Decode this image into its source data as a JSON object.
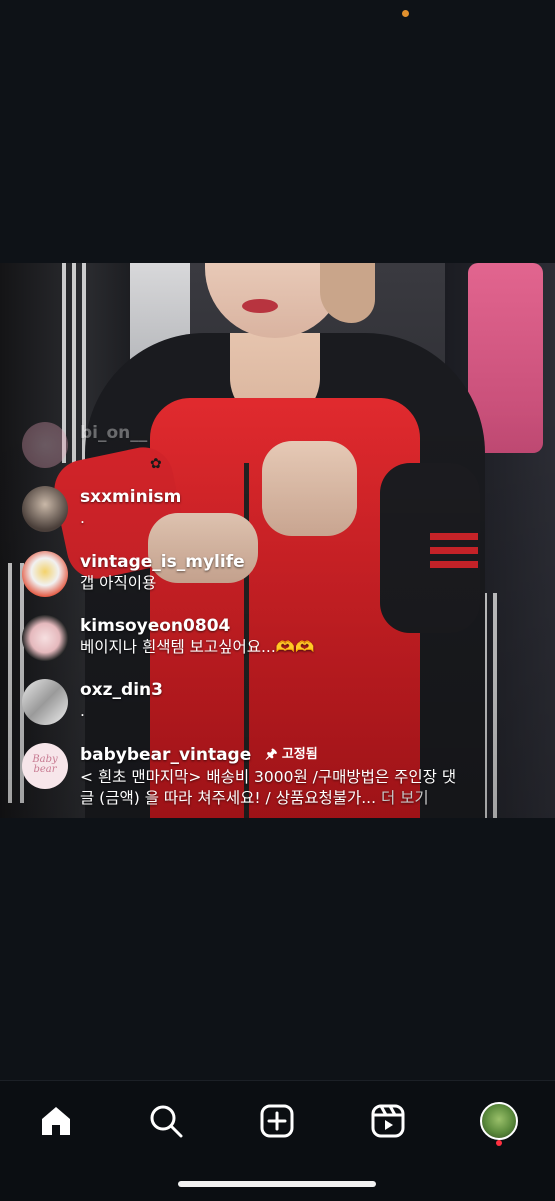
{
  "comments": [
    {
      "user": "bi_on__",
      "message": ""
    },
    {
      "user": "sxxminism",
      "message": "."
    },
    {
      "user": "vintage_is_mylife",
      "message": "갭 아직이용"
    },
    {
      "user": "kimsoyeon0804",
      "message": "베이지나 흰색템 보고싶어요...🫶🫶"
    },
    {
      "user": "oxz_din3",
      "message": "."
    },
    {
      "user": "babybear_vintage",
      "pinned_label": "고정됨",
      "message_line1": "< 흰초 맨마지막> 배송비 3000원 /구매방법은 주인장 댓",
      "message_line2": "글 (금액) 을 따라 쳐주세요! / 상품요청불가...",
      "more": "더 보기"
    }
  ],
  "nav": {
    "items": [
      "home-icon",
      "search-icon",
      "create-icon",
      "reels-icon",
      "profile-avatar"
    ]
  },
  "colors": {
    "background": "#0e1217",
    "accent_notification": "#ff3040",
    "status_dot": "#e0902e"
  }
}
